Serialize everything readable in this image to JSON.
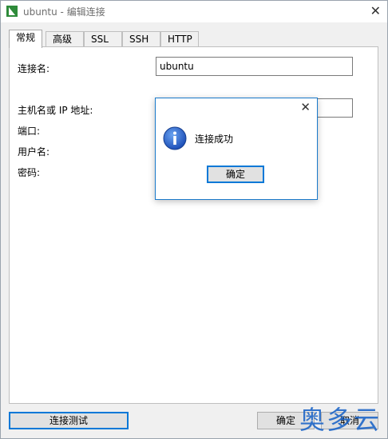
{
  "window": {
    "title": "ubuntu - 编辑连接"
  },
  "tabs": [
    "常规",
    "高级",
    "SSL",
    "SSH",
    "HTTP"
  ],
  "form": {
    "connection_name_label": "连接名:",
    "connection_name_value": "ubuntu",
    "host_label": "主机名或 IP 地址:",
    "port_label": "端口:",
    "username_label": "用户名:",
    "password_label": "密码:"
  },
  "footer": {
    "test_button": "连接测试",
    "ok_button": "确定",
    "cancel_button": "取消"
  },
  "watermark": "奥多云",
  "dialog": {
    "message": "连接成功",
    "ok_button": "确定"
  }
}
